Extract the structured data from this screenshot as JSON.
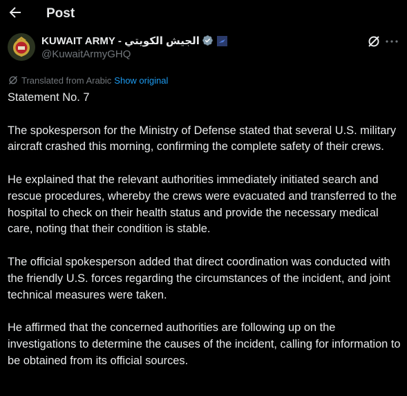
{
  "header": {
    "title": "Post",
    "back_icon": "arrow-left-icon"
  },
  "author": {
    "name": "KUWAIT ARMY - الجيش الكويتي",
    "handle": "@KuwaitArmyGHQ",
    "verified": true,
    "verified_color": "#829aab",
    "affiliate_badge_color": "#2a3a6a"
  },
  "actions": {
    "grok_icon": "grok-slash-circle-icon",
    "more_icon": "more-dots-icon"
  },
  "translation": {
    "label": "Translated from Arabic",
    "show_original": "Show original",
    "link_color": "#1d9bf0"
  },
  "post": {
    "paragraphs": [
      "Statement No. 7",
      "The spokesperson for the Ministry of Defense stated that several U.S. military aircraft crashed this morning, confirming the complete safety of their crews.",
      "He explained that the relevant authorities immediately initiated search and rescue procedures, whereby the crews were evacuated and transferred to the hospital to check on their health status and provide the necessary medical care, noting that their condition is stable.",
      "The official spokesperson added that direct coordination was conducted with the friendly U.S. forces regarding the circumstances of the incident, and joint technical measures were taken.",
      "He affirmed that the concerned authorities are following up on the investigations to determine the causes of the incident, calling for information to be obtained from its official sources."
    ]
  },
  "colors": {
    "background": "#000000",
    "text_primary": "#e7e9ea",
    "text_secondary": "#71767b"
  }
}
